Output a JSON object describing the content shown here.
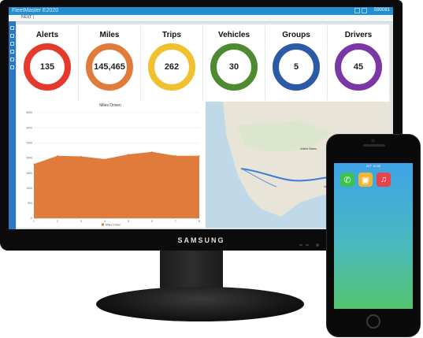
{
  "app": {
    "title": "FleetMaster E2020",
    "user": "S90081",
    "menu_label": "NEXT |"
  },
  "kpis": [
    {
      "title": "Alerts",
      "value": "135",
      "color": "#e53a2b"
    },
    {
      "title": "Miles",
      "value": "145,465",
      "color": "#e07b3c"
    },
    {
      "title": "Trips",
      "value": "262",
      "color": "#f2bf2e"
    },
    {
      "title": "Vehicles",
      "value": "30",
      "color": "#4e8a2f"
    },
    {
      "title": "Groups",
      "value": "5",
      "color": "#2b5aa8"
    },
    {
      "title": "Drivers",
      "value": "45",
      "color": "#7a37a6"
    }
  ],
  "chart_data": {
    "type": "area",
    "title": "Miles Driven",
    "x": [
      "1",
      "2",
      "3",
      "4",
      "5",
      "6",
      "7",
      "8"
    ],
    "series": [
      {
        "values": [
          1800,
          2070,
          2050,
          1960,
          2120,
          2200,
          2070,
          2070
        ],
        "color": "#e07b3c"
      }
    ],
    "ylim": [
      0,
      3500
    ],
    "yticks": [
      0,
      500,
      1000,
      1500,
      2000,
      2500,
      3000,
      3500
    ],
    "grid": true,
    "legend_label": "Miles Driven"
  },
  "map": {
    "state_label_1": "United States",
    "state_label_2": "United States",
    "route_color": "#3d7fd8"
  },
  "device": {
    "brand": "SAMSUNG"
  },
  "phone": {
    "status": "ATT 12:00",
    "apps": [
      {
        "icon": "phone-app-icon",
        "glyph": "✆",
        "color": "#3cc24e"
      },
      {
        "icon": "fleet-app-icon",
        "glyph": "▣",
        "color": "#f2b632"
      },
      {
        "icon": "music-app-icon",
        "glyph": "♫",
        "color": "#e8434d"
      }
    ]
  }
}
